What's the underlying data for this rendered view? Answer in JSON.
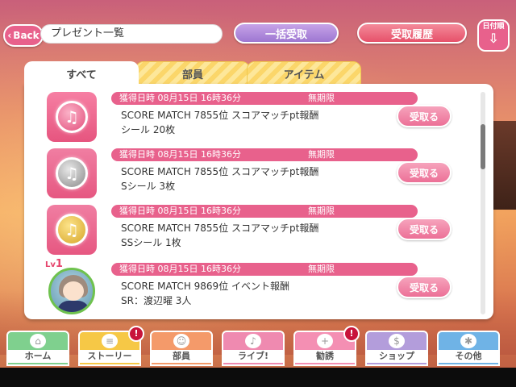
{
  "header": {
    "back_label": "Back",
    "title": "プレゼント一覧",
    "bulk_receive": "一括受取",
    "history": "受取履歴",
    "sort_label": "日付順"
  },
  "tabs": [
    {
      "label": "すべて"
    },
    {
      "label": "部員"
    },
    {
      "label": "アイテム"
    }
  ],
  "items": [
    {
      "date": "獲得日時 08月15日 16時36分",
      "limit": "無期限",
      "line1": "SCORE MATCH 7855位 スコアマッチpt報酬",
      "line2": "シール 20枚",
      "button": "受取る",
      "icon": "music-note-pink-icon"
    },
    {
      "date": "獲得日時 08月15日 16時36分",
      "limit": "無期限",
      "line1": "SCORE MATCH 7855位 スコアマッチpt報酬",
      "line2": "Sシール 3枚",
      "button": "受取る",
      "icon": "music-note-silver-icon"
    },
    {
      "date": "獲得日時 08月15日 16時36分",
      "limit": "無期限",
      "line1": "SCORE MATCH 7855位 スコアマッチpt報酬",
      "line2": "SSシール 1枚",
      "button": "受取る",
      "icon": "music-note-gold-icon"
    },
    {
      "date": "獲得日時 08月15日 16時36分",
      "limit": "無期限",
      "line1": "SCORE MATCH 9869位 イベント報酬",
      "line2": "SR：渡辺曜 3人",
      "button": "受取る",
      "icon": "member-avatar",
      "level_prefix": "Lv",
      "level": "1"
    }
  ],
  "nav": [
    {
      "label": "ホーム",
      "color": "#7fd08e",
      "icon": "home-icon",
      "glyph": "⌂",
      "badge": ""
    },
    {
      "label": "ストーリー",
      "color": "#f6c846",
      "icon": "story-icon",
      "glyph": "≡",
      "badge": "!"
    },
    {
      "label": "部員",
      "color": "#f49a6a",
      "icon": "member-icon",
      "glyph": "☺",
      "badge": ""
    },
    {
      "label": "ライブ!",
      "color": "#ef8ab0",
      "icon": "live-icon",
      "glyph": "♪",
      "badge": ""
    },
    {
      "label": "勧誘",
      "color": "#f48fb3",
      "icon": "scout-icon",
      "glyph": "+",
      "badge": "!"
    },
    {
      "label": "ショップ",
      "color": "#b39ddb",
      "icon": "shop-icon",
      "glyph": "$",
      "badge": ""
    },
    {
      "label": "その他",
      "color": "#6fb3e6",
      "icon": "other-icon",
      "glyph": "✱",
      "badge": ""
    }
  ]
}
